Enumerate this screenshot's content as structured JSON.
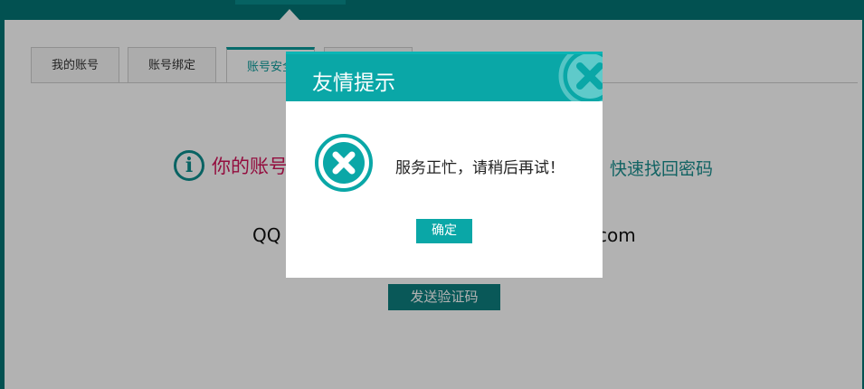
{
  "tabs": [
    {
      "label": "我的账号",
      "active": false
    },
    {
      "label": "账号绑定",
      "active": false
    },
    {
      "label": "账号安全",
      "active": true
    },
    {
      "label": "",
      "active": false
    }
  ],
  "notice": {
    "text": "你的账号",
    "recover_link": "快速找回密码"
  },
  "binding": {
    "qq_prefix": "QQ",
    "email_suffix": "com"
  },
  "send_button_label": "发送验证码",
  "modal": {
    "title": "友情提示",
    "message": "服务正忙，请稍后再试！",
    "confirm_label": "确定"
  },
  "colors": {
    "teal_dark": "#047474",
    "teal": "#0aa7a7",
    "alert_pink": "#d3145a"
  },
  "icons": {
    "info": "info-circle-icon",
    "error": "error-x-circle-icon",
    "close": "close-x-circle-icon"
  }
}
